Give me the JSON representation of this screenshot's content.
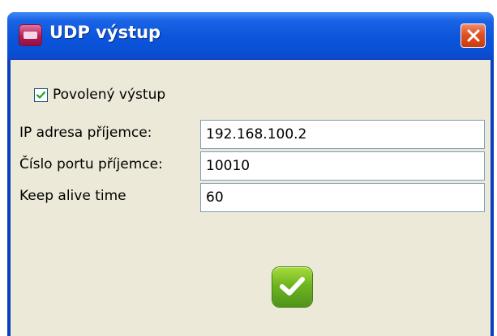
{
  "window": {
    "title": "UDP výstup",
    "app_icon": "app-icon",
    "close_icon": "close-icon"
  },
  "checkbox": {
    "label": "Povolený výstup",
    "checked": true
  },
  "fields": [
    {
      "label": "IP adresa příjemce:",
      "value": "192.168.100.2"
    },
    {
      "label": "Číslo portu příjemce:",
      "value": "10010"
    },
    {
      "label": "Keep alive time",
      "value": "60"
    }
  ],
  "ok_button": {
    "icon": "checkmark-icon"
  },
  "colors": {
    "titlebar": "#0b55db",
    "client": "#ece9d8",
    "close_button": "#e0511f",
    "ok_button": "#6fb520"
  }
}
